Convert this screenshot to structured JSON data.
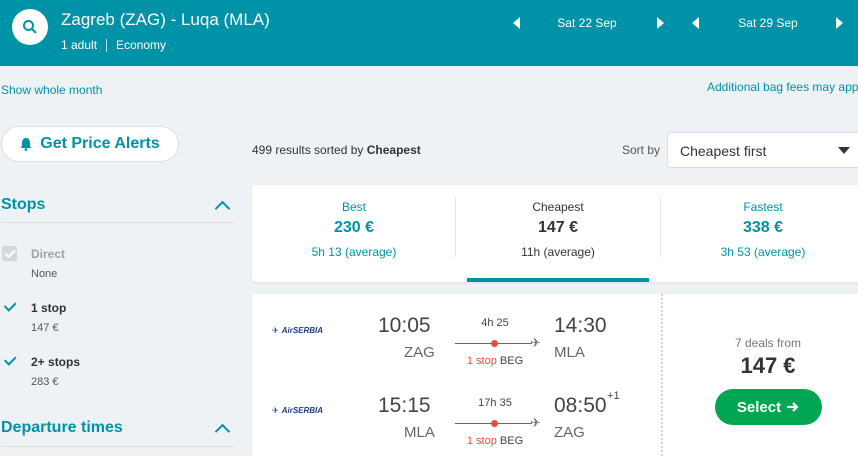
{
  "header": {
    "route": "Zagreb (ZAG) - Luqa (MLA)",
    "passengers": "1 adult",
    "cabin": "Economy",
    "depart_date": "Sat 22 Sep",
    "return_date": "Sat 29 Sep"
  },
  "links": {
    "show_month": "Show whole month",
    "bag_fees": "Additional bag fees may app"
  },
  "alerts_button": "Get Price Alerts",
  "filters": {
    "stops_title": "Stops",
    "options": [
      {
        "label": "Direct",
        "price": "None",
        "checked": true,
        "disabled": true
      },
      {
        "label": "1 stop",
        "price": "147 €",
        "checked": true,
        "disabled": false
      },
      {
        "label": "2+ stops",
        "price": "283 €",
        "checked": true,
        "disabled": false
      }
    ],
    "departure_title": "Departure times"
  },
  "results": {
    "count_text": "499 results sorted by ",
    "sorted_by": "Cheapest",
    "sort_label": "Sort by",
    "sort_value": "Cheapest first"
  },
  "tabs": [
    {
      "name": "Best",
      "price": "230 €",
      "duration": "5h 13 (average)"
    },
    {
      "name": "Cheapest",
      "price": "147 €",
      "duration": "11h (average)"
    },
    {
      "name": "Fastest",
      "price": "338 €",
      "duration": "3h 53 (average)"
    }
  ],
  "result": {
    "airline": "AirSERBIA",
    "outbound": {
      "dep_time": "10:05",
      "dep_code": "ZAG",
      "duration": "4h 25",
      "stops": "1 stop",
      "via": "BEG",
      "arr_time": "14:30",
      "arr_code": "MLA",
      "day_offset": ""
    },
    "inbound": {
      "dep_time": "15:15",
      "dep_code": "MLA",
      "duration": "17h 35",
      "stops": "1 stop",
      "via": "BEG",
      "arr_time": "08:50",
      "arr_code": "ZAG",
      "day_offset": "+1"
    },
    "deals": "7 deals from",
    "price": "147 €",
    "select_label": "Select"
  },
  "colors": {
    "brand": "#0093a8",
    "select": "#00a651",
    "stop_dot": "#e74c3c"
  }
}
